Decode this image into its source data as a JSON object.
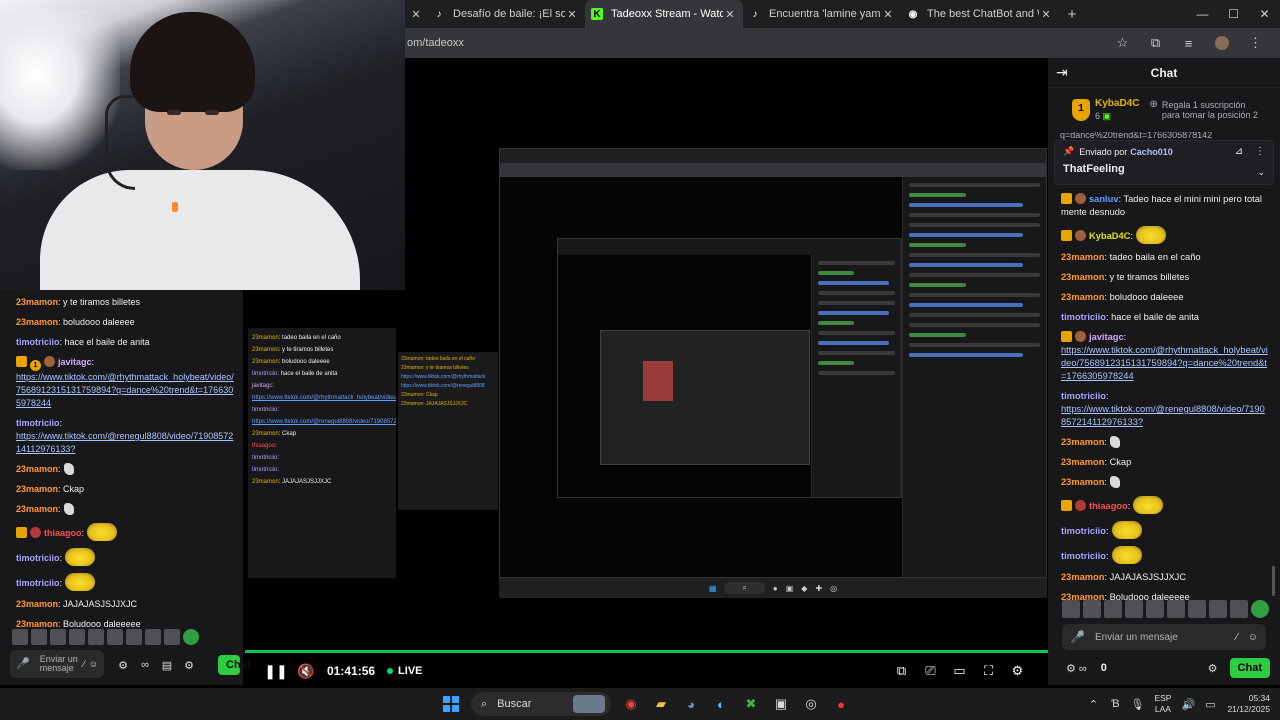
{
  "browser": {
    "tabs": [
      {
        "title": "Desafío de baile: ¡El sol brilla fu",
        "icon": "tiktok-icon"
      },
      {
        "title": "Tadeoxx Stream - Watch Live o",
        "icon": "kick-icon",
        "active": true
      },
      {
        "title": "Encuentra 'lamine yamal baile'",
        "icon": "tiktok-icon"
      },
      {
        "title": "The best ChatBot and Widgets",
        "icon": "botrix-icon"
      }
    ],
    "url": "om/tadeoxx"
  },
  "player": {
    "time": "01:41:56",
    "live_label": "LIVE",
    "accent": "#00c853"
  },
  "left_chat": {
    "messages": [
      {
        "user": "23mamon",
        "color": "#ff9a2e",
        "text": ": y te tiramos billetes"
      },
      {
        "user": "23mamon",
        "color": "#ff9a2e",
        "text": ": boludooo daleeee"
      },
      {
        "user": "timotriciio",
        "color": "#a9a4ff",
        "text": ": hace el baile de anita"
      },
      {
        "user": "javitagc",
        "color": "#d4a5ff",
        "badge_num": "1",
        "text": ":",
        "link": "https://www.tiktok.com/@rhythmattack_holybeat/video/7568912315131759894?q=dance%20trend&t=1766305978244"
      },
      {
        "user": "timotriciio",
        "color": "#a9a4ff",
        "text": ":",
        "link": "https://www.tiktok.com/@renegul8808/video/7190857214112976133?"
      },
      {
        "user": "23mamon",
        "color": "#ff9a2e",
        "text": ":",
        "emote": "small"
      },
      {
        "user": "23mamon",
        "color": "#ff9a2e",
        "text": ": Ckap"
      },
      {
        "user": "23mamon",
        "color": "#ff9a2e",
        "text": ":",
        "emote": "small"
      },
      {
        "user": "thiaagoo",
        "color": "#ff4d4d",
        "text": ":",
        "emote": "big"
      },
      {
        "user": "timotriciio",
        "color": "#a9a4ff",
        "text": ":",
        "emote": "big"
      },
      {
        "user": "timotriciio",
        "color": "#a9a4ff",
        "text": ":",
        "emote": "big"
      },
      {
        "user": "23mamon",
        "color": "#ff9a2e",
        "text": ": JAJAJASJSJJXJC"
      },
      {
        "user": "23mamon",
        "color": "#ff9a2e",
        "text": ": Boludooo daleeeee"
      }
    ],
    "input_placeholder": "Enviar un mensaje",
    "chat_button": "Chat"
  },
  "chat_panel": {
    "title": "Chat",
    "leader": {
      "name": "KybaD4C",
      "rank": "1",
      "subs": "6",
      "gift_text": "Regala 1 suscripción para tomar la posición 2"
    },
    "cut_text": "q=dance%20trend&t=1766305878142",
    "pinned": {
      "label": "Enviado por",
      "by": "Cacho010",
      "message": "ThatFeeling"
    },
    "messages": [
      {
        "user": "sanluv",
        "color": "#5aa0ff",
        "text": ": Tadeo hace el mini mini pero totalmente desnudo"
      },
      {
        "user": "KybaD4C",
        "color": "#e3e300",
        "text": ":",
        "emote": "big"
      },
      {
        "user": "23mamon",
        "color": "#ff9a2e",
        "text": ": tadeo baila en el caño"
      },
      {
        "user": "23mamon",
        "color": "#ff9a2e",
        "text": ": y te tiramos billetes"
      },
      {
        "user": "23mamon",
        "color": "#ff9a2e",
        "text": ": boludooo daleeee"
      },
      {
        "user": "timotriciio",
        "color": "#a9a4ff",
        "text": ": hace el baile de anita"
      },
      {
        "user": "javitagc",
        "color": "#d4a5ff",
        "text": ":",
        "link": "https://www.tiktok.com/@rhythmattack_holybeat/video/7568912315131759894?q=dance%20trend&t=1766305978244"
      },
      {
        "user": "timotriciio",
        "color": "#a9a4ff",
        "text": ":",
        "link": "https://www.tiktok.com/@renegul8808/video/7190857214112976133?"
      },
      {
        "user": "23mamon",
        "color": "#ff9a2e",
        "text": ":",
        "emote": "small"
      },
      {
        "user": "23mamon",
        "color": "#ff9a2e",
        "text": ": Ckap"
      },
      {
        "user": "23mamon",
        "color": "#ff9a2e",
        "text": ":",
        "emote": "small"
      },
      {
        "user": "thiaagoo",
        "color": "#ff4d4d",
        "text": ":",
        "emote": "big"
      },
      {
        "user": "timotriciio",
        "color": "#a9a4ff",
        "text": ":",
        "emote": "big"
      },
      {
        "user": "timotriciio",
        "color": "#a9a4ff",
        "text": ":",
        "emote": "big"
      },
      {
        "user": "23mamon",
        "color": "#ff9a2e",
        "text": ": JAJAJASJSJJXJC"
      },
      {
        "user": "23mamon",
        "color": "#ff9a2e",
        "text": ": Boludooo daleeeee"
      }
    ],
    "input_placeholder": "Enviar un mensaje",
    "points": "0",
    "chat_button": "Chat"
  },
  "taskbar": {
    "search_label": "Buscar",
    "lang_top": "ESP",
    "lang_bottom": "LAA",
    "time": "05:34",
    "date": "21/12/2025"
  }
}
